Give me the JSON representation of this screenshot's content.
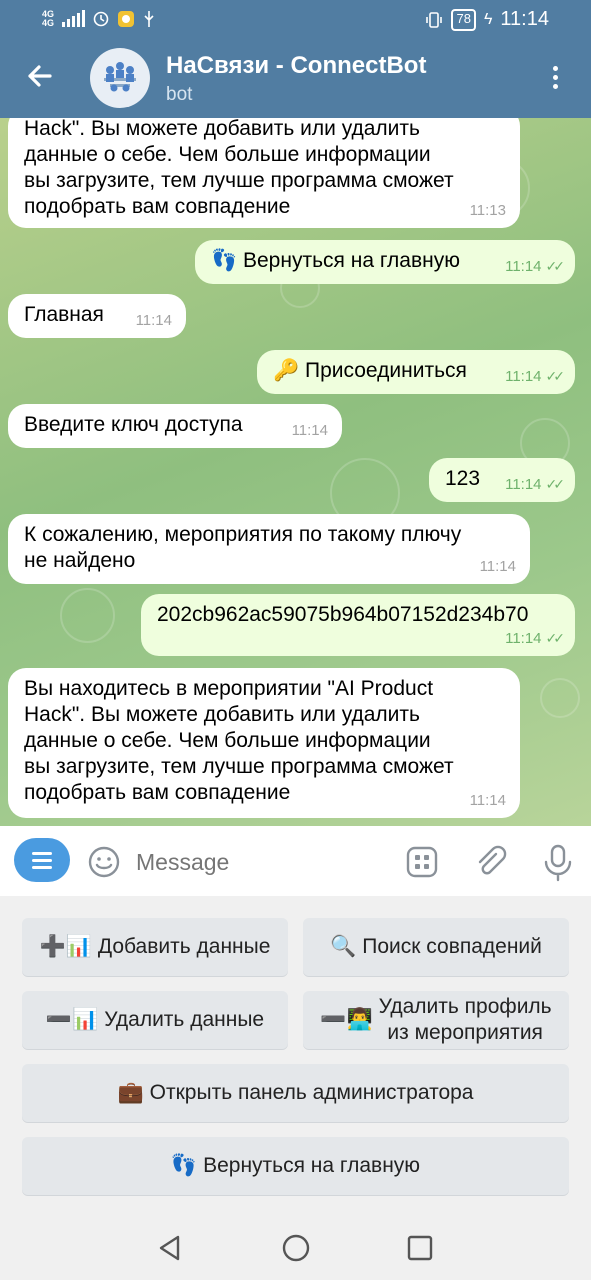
{
  "status_bar": {
    "network": "4G",
    "network_sub": "4G",
    "battery": "78",
    "time": "11:14"
  },
  "header": {
    "title": "НаСвязи - ConnectBot",
    "subtitle": "bot"
  },
  "messages": [
    {
      "dir": "in",
      "lines": [
        "Hack\". Вы можете добавить или удалить",
        "данные о себе. Чем больше информации",
        "вы загрузите, тем лучше программа сможет",
        "подобрать вам совпадение"
      ],
      "time": "11:13"
    },
    {
      "dir": "out",
      "icon": "👣",
      "text": "Вернуться на главную",
      "time": "11:14"
    },
    {
      "dir": "in",
      "text": "Главная",
      "time": "11:14"
    },
    {
      "dir": "out",
      "icon": "🔑",
      "text": "Присоединиться",
      "time": "11:14"
    },
    {
      "dir": "in",
      "text": "Введите ключ доступа",
      "time": "11:14"
    },
    {
      "dir": "out",
      "text": "123",
      "time": "11:14"
    },
    {
      "dir": "in",
      "lines": [
        "К сожалению, мероприятия по такому плючу",
        "не найдено"
      ],
      "time": "11:14"
    },
    {
      "dir": "out",
      "text": "202cb962ac59075b964b07152d234b70",
      "time": "11:14"
    },
    {
      "dir": "in",
      "lines": [
        "Вы находитесь в мероприятии \"AI Product",
        "Hack\". Вы можете добавить или удалить",
        "данные о себе. Чем больше информации",
        "вы загрузите, тем лучше программа сможет",
        "подобрать вам совпадение"
      ],
      "time": "11:14"
    }
  ],
  "input": {
    "placeholder": "Message"
  },
  "keyboard": {
    "add_data": {
      "icon": "➕📊",
      "label": "Добавить данные"
    },
    "search_matches": {
      "icon": "🔍",
      "label": "Поиск совпадений"
    },
    "delete_data": {
      "icon": "➖📊",
      "label": "Удалить данные"
    },
    "delete_profile": {
      "icon": "➖👨‍💻",
      "label_line1": "Удалить профиль",
      "label_line2": "из мероприятия"
    },
    "admin_panel": {
      "icon": "💼",
      "label": "Открыть панель администратора"
    },
    "back_main": {
      "icon": "👣",
      "label": "Вернуться на главную"
    }
  },
  "colors": {
    "header": "#517da2",
    "outgoing_bubble": "#effedd",
    "incoming_bubble": "#ffffff",
    "accent": "#4a9be0",
    "read_checks": "#6fb26c"
  },
  "icons": {
    "back": "arrow-left-icon",
    "menu": "more-vertical-icon",
    "emoji": "smile-icon",
    "keyboard": "keyboard-icon",
    "attach": "paperclip-icon",
    "mic": "microphone-icon"
  }
}
